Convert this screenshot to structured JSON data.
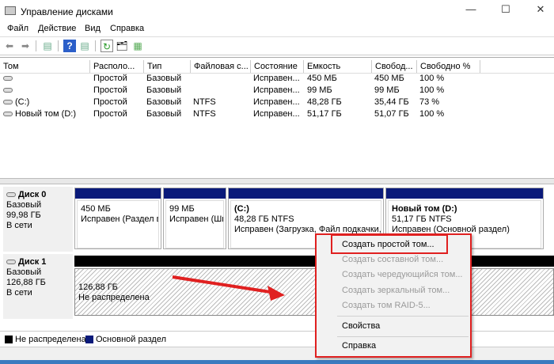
{
  "window": {
    "title": "Управление дисками",
    "controls": [
      "—",
      "☐",
      "✕"
    ]
  },
  "menu": [
    "Файл",
    "Действие",
    "Вид",
    "Справка"
  ],
  "toolbar": [
    "back-icon",
    "forward-icon",
    "console-tree-icon",
    "help-icon",
    "action-pane-icon",
    "refresh-icon",
    "properties-icon",
    "settings-icon"
  ],
  "table": {
    "headers": [
      "Том",
      "Располо...",
      "Тип",
      "Файловая с...",
      "Состояние",
      "Емкость",
      "Свобод...",
      "Свободно %"
    ],
    "rows": [
      [
        "",
        "Простой",
        "Базовый",
        "",
        "Исправен...",
        "450 МБ",
        "450 МБ",
        "100 %"
      ],
      [
        "",
        "Простой",
        "Базовый",
        "",
        "Исправен...",
        "99 МБ",
        "99 МБ",
        "100 %"
      ],
      [
        "(C:)",
        "Простой",
        "Базовый",
        "NTFS",
        "Исправен...",
        "48,28 ГБ",
        "35,44 ГБ",
        "73 %"
      ],
      [
        "Новый том (D:)",
        "Простой",
        "Базовый",
        "NTFS",
        "Исправен...",
        "51,17 ГБ",
        "51,07 ГБ",
        "100 %"
      ]
    ]
  },
  "disks": [
    {
      "name": "Диск 0",
      "type": "Базовый",
      "size": "99,98 ГБ",
      "status": "В сети",
      "partitions": [
        {
          "name": "",
          "size": "450 МБ",
          "state": "Исправен (Раздел во"
        },
        {
          "name": "",
          "size": "99 МБ",
          "state": "Исправен (Ши"
        },
        {
          "name": "(C:)",
          "size": "48,28 ГБ NTFS",
          "state": "Исправен (Загрузка, Файл подкачки, А"
        },
        {
          "name": "Новый том  (D:)",
          "size": "51,17 ГБ NTFS",
          "state": "Исправен (Основной раздел)"
        }
      ]
    },
    {
      "name": "Диск 1",
      "type": "Базовый",
      "size": "126,88 ГБ",
      "status": "В сети",
      "partitions": [
        {
          "size": "126,88 ГБ",
          "state": "Не распределена"
        }
      ]
    }
  ],
  "legend": [
    {
      "label": "Не распределена",
      "color": "#000000"
    },
    {
      "label": "Основной раздел",
      "color": "#0a1a7a"
    }
  ],
  "context_menu": {
    "items": [
      {
        "label": "Создать простой том...",
        "enabled": true
      },
      {
        "label": "Создать составной том...",
        "enabled": false
      },
      {
        "label": "Создать чередующийся том...",
        "enabled": false
      },
      {
        "label": "Создать зеркальный том...",
        "enabled": false
      },
      {
        "label": "Создать том RAID-5...",
        "enabled": false
      },
      {
        "label": "Свойства",
        "enabled": true
      },
      {
        "label": "Справка",
        "enabled": true
      }
    ]
  },
  "colors": {
    "primary_partition": "#0a1a7a",
    "unallocated": "#000000",
    "annotation": "#e02020"
  }
}
